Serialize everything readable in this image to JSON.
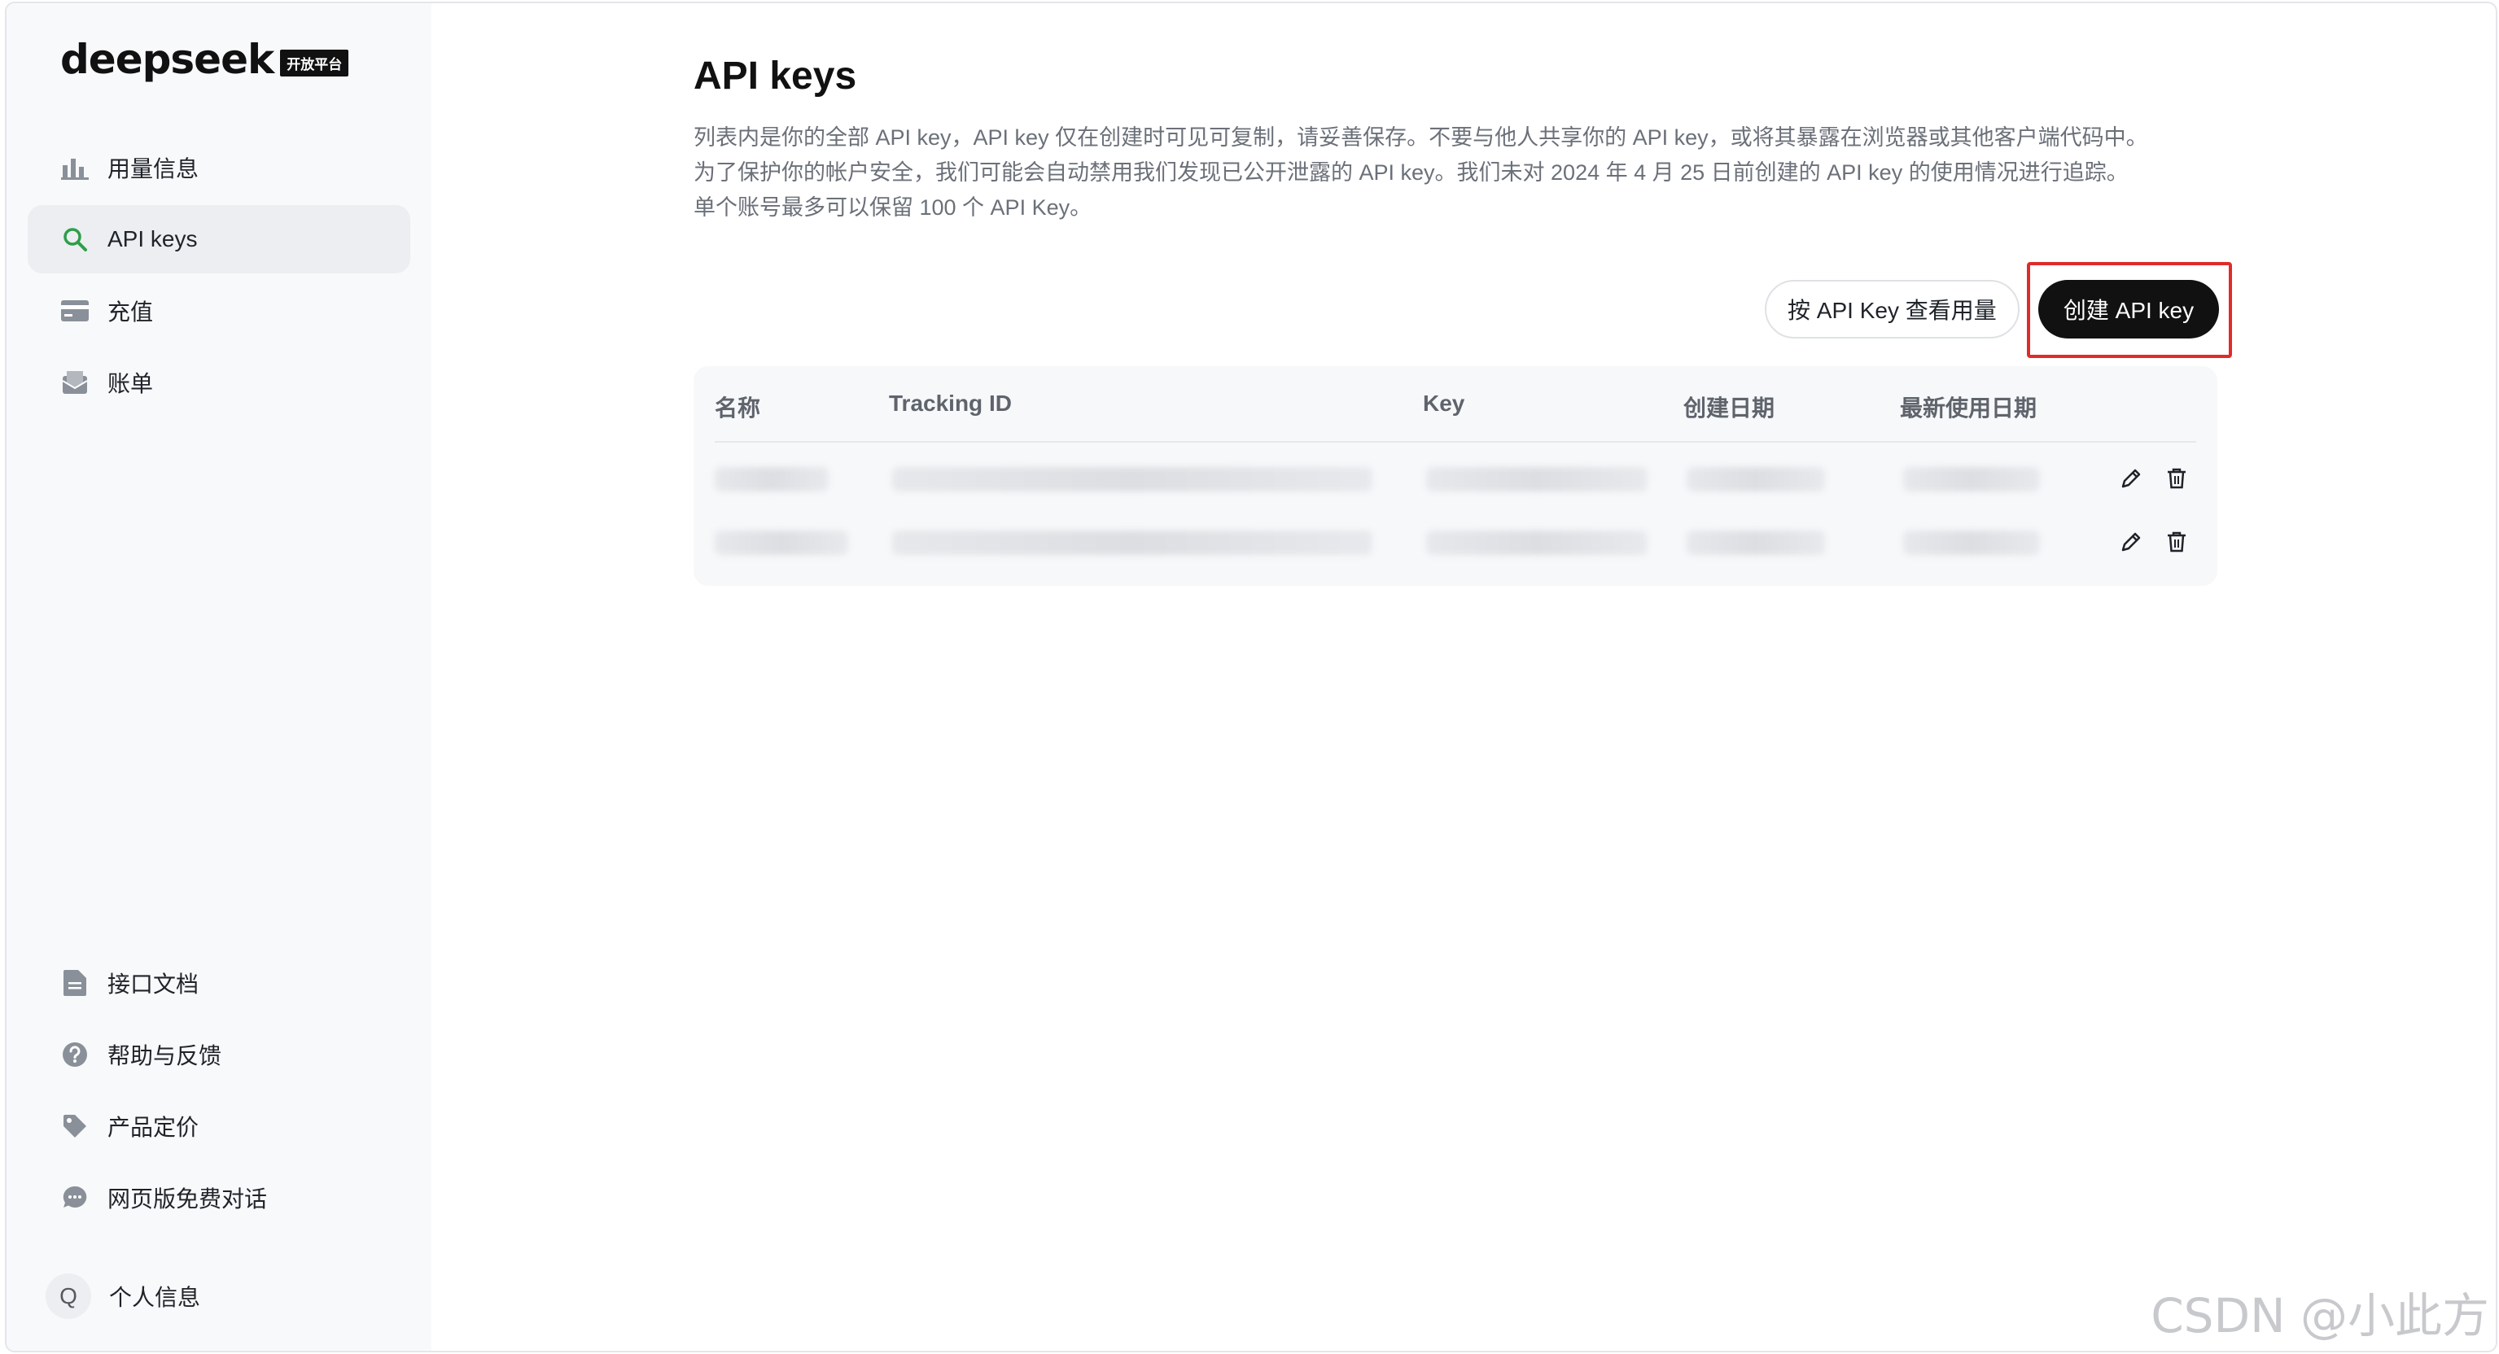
{
  "sidebar": {
    "logo_text": "deepseek",
    "logo_badge": "开放平台",
    "top_items": [
      {
        "label": "用量信息",
        "icon": "bar-chart-icon"
      },
      {
        "label": "API keys",
        "icon": "search-icon",
        "active": true
      },
      {
        "label": "充值",
        "icon": "credit-card-icon"
      },
      {
        "label": "账单",
        "icon": "bill-icon"
      }
    ],
    "bottom_items": [
      {
        "label": "接口文档",
        "icon": "document-icon"
      },
      {
        "label": "帮助与反馈",
        "icon": "help-icon"
      },
      {
        "label": "产品定价",
        "icon": "tag-icon"
      },
      {
        "label": "网页版免费对话",
        "icon": "chat-icon"
      }
    ],
    "profile": {
      "avatar_letter": "Q",
      "label": "个人信息"
    }
  },
  "main": {
    "title": "API keys",
    "description": [
      "列表内是你的全部 API key，API key 仅在创建时可见可复制，请妥善保存。不要与他人共享你的 API key，或将其暴露在浏览器或其他客户端代码中。",
      "为了保护你的帐户安全，我们可能会自动禁用我们发现已公开泄露的 API key。我们未对 2024 年 4 月 25 日前创建的 API key 的使用情况进行追踪。",
      "单个账号最多可以保留 100 个 API Key。"
    ],
    "buttons": {
      "usage_by_key": "按 API Key 查看用量",
      "create_key": "创建 API key"
    },
    "table": {
      "columns": [
        "名称",
        "Tracking ID",
        "Key",
        "创建日期",
        "最新使用日期"
      ],
      "row_count": 2
    }
  },
  "accent_colors": {
    "primary_button": "#111111",
    "highlight_border": "#e02b2b",
    "active_icon": "#2e9e4a"
  },
  "watermark": "CSDN @小此方"
}
